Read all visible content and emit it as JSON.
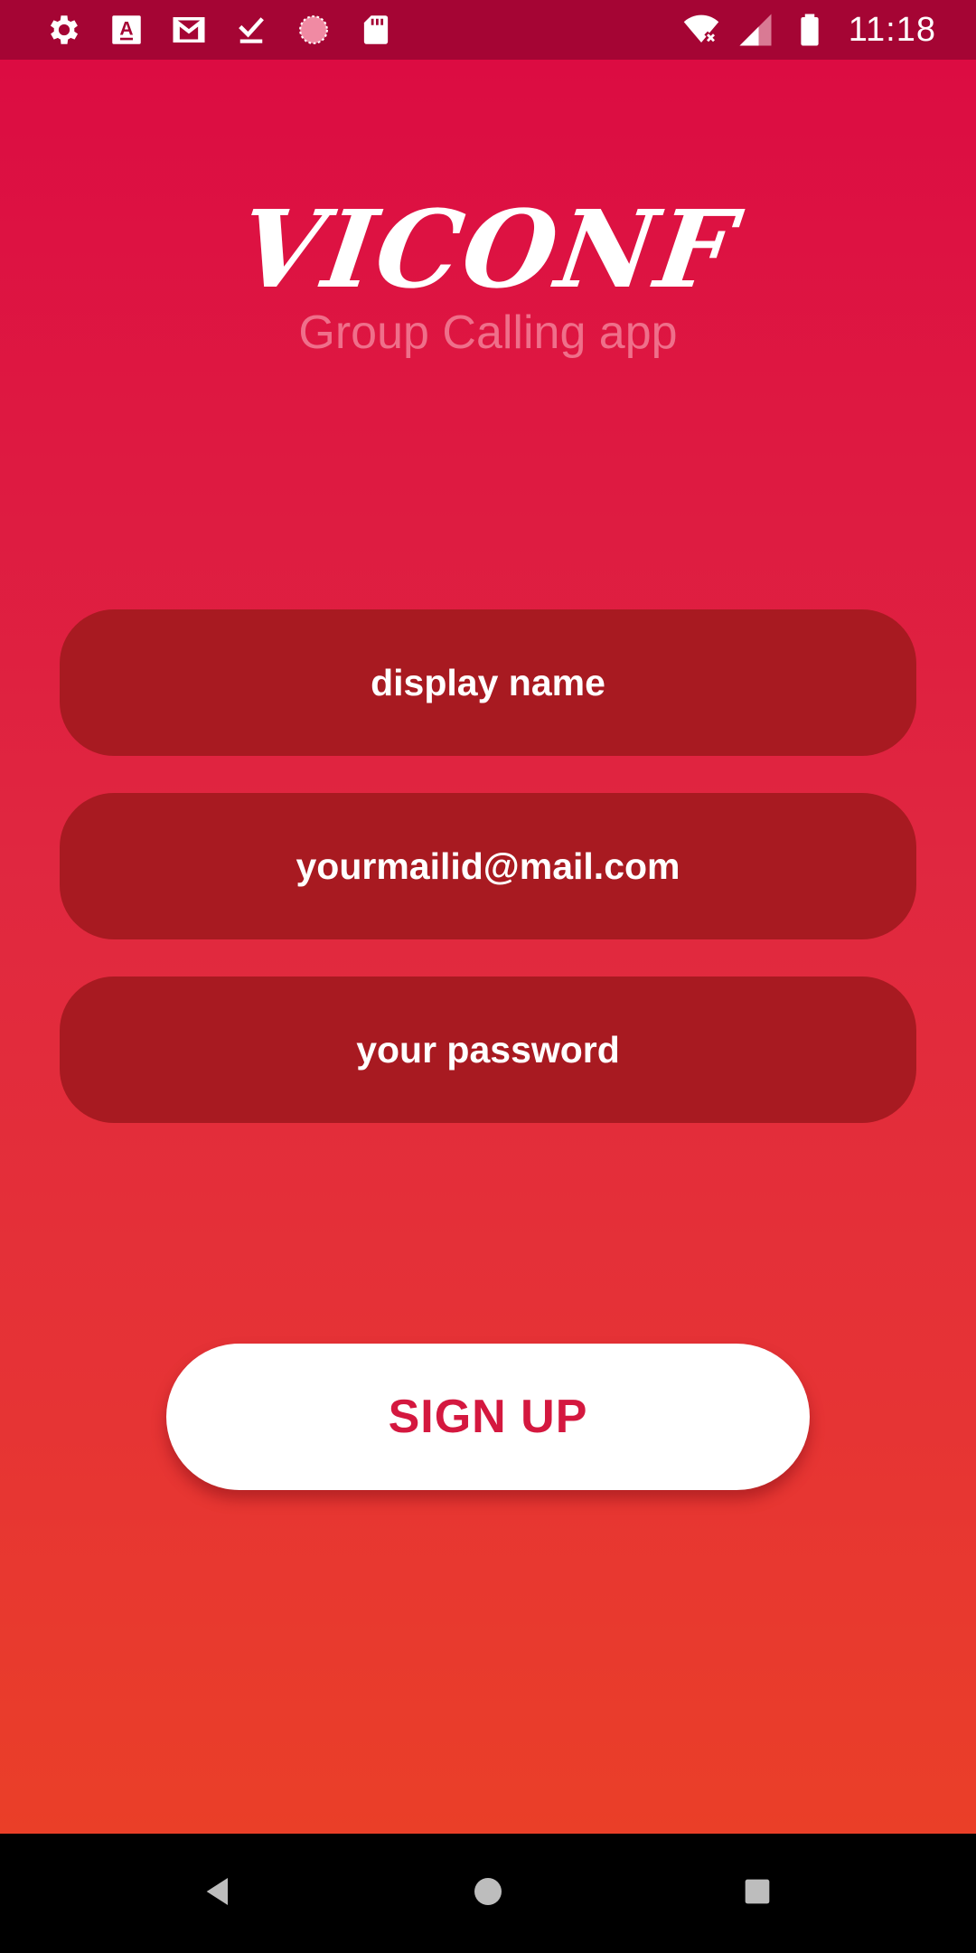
{
  "status_bar": {
    "time": "11:18",
    "left_icons": [
      "settings-icon",
      "font-a-icon",
      "gmail-icon",
      "download-done-icon",
      "sync-circle-icon",
      "sd-card-icon"
    ],
    "right_icons": [
      "wifi-off-icon",
      "signal-icon",
      "battery-icon"
    ]
  },
  "app": {
    "logo": "VICONF",
    "subtitle": "Group Calling app"
  },
  "form": {
    "display_name_placeholder": "display name",
    "email_placeholder": "yourmailid@mail.com",
    "password_placeholder": "your password",
    "signup_label": "SIGN UP"
  },
  "nav_bar": {
    "buttons": [
      "back-icon",
      "home-icon",
      "recents-icon"
    ]
  },
  "colors": {
    "status_bar_bg": "#a50534",
    "gradient_top": "#dc0c42",
    "gradient_bottom": "#ea3f28",
    "field_bg": "#a81a21",
    "signup_text": "#d4183f",
    "subtitle_text": "#ef6f8a"
  }
}
